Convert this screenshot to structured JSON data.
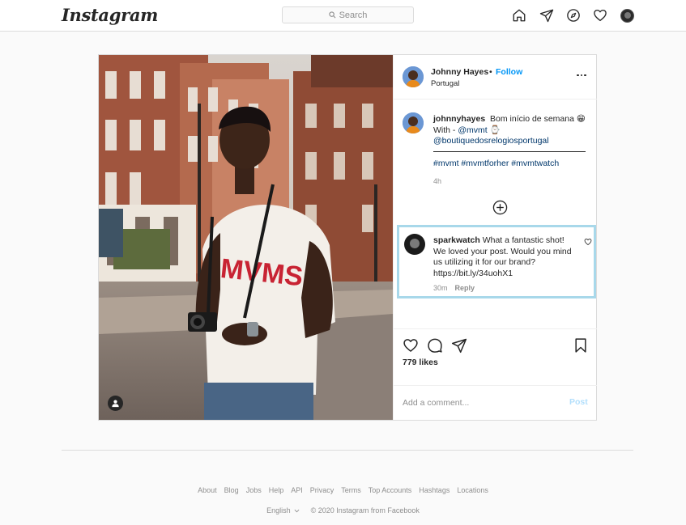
{
  "header": {
    "logo": "Instagram",
    "search_placeholder": "Search",
    "icons": [
      "home-icon",
      "direct-icon",
      "explore-icon",
      "activity-heart-icon",
      "profile-avatar"
    ]
  },
  "post": {
    "author": {
      "name": "Johnny Hayes",
      "separator": "•",
      "follow": "Follow",
      "location": "Portugal"
    },
    "caption": {
      "username": "johnnyhayes",
      "text": "Bom início de semana 😁",
      "with_prefix": "With -",
      "mention1": "@mvmt",
      "watch_emoji": "⌚",
      "mention2": "@boutiquedosrelogiosportugal",
      "hashtags": "#mvmt #mvmtforher #mvmtwatch",
      "time": "4h"
    },
    "comment": {
      "username": "sparkwatch",
      "text": "What a fantastic shot! We loved your post. Would you mind us utilizing it for our brand? https://bit.ly/34uohX1",
      "time": "30m",
      "reply": "Reply"
    },
    "likes": "779 likes",
    "add_comment_placeholder": "Add a comment...",
    "post_button": "Post"
  },
  "footer": {
    "links": [
      "About",
      "Blog",
      "Jobs",
      "Help",
      "API",
      "Privacy",
      "Terms",
      "Top Accounts",
      "Hashtags",
      "Locations"
    ],
    "language": "English",
    "copyright": "© 2020 Instagram from Facebook"
  },
  "colors": {
    "link_blue": "#0095f6",
    "mention_blue": "#00376b",
    "highlight_border": "#a8d8ea",
    "text_gray": "#8e8e8e"
  }
}
